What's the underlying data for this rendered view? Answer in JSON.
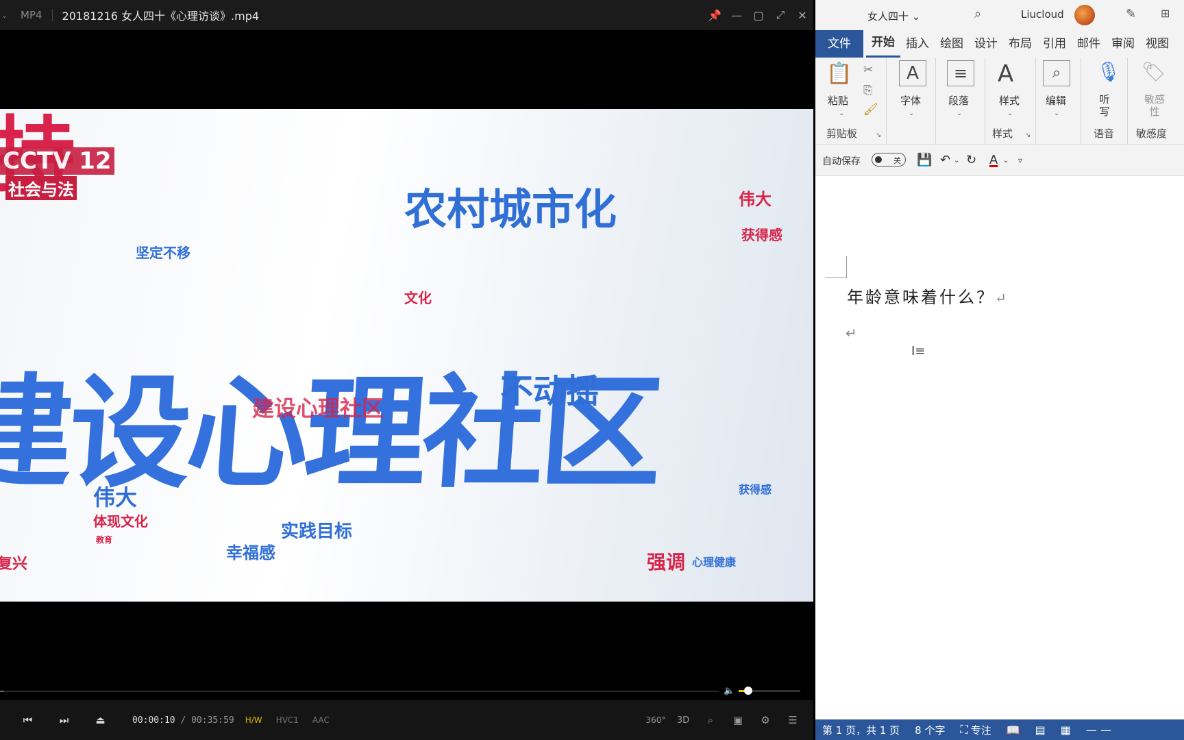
{
  "player": {
    "format": "MP4",
    "filename": "20181216 女人四十《心理访谈》.mp4",
    "window_buttons": [
      "📌",
      "—",
      "▢",
      "⤢",
      "✕"
    ],
    "video_text": {
      "top_left_red": "持",
      "logo": "CCTV 12",
      "logo_sub": "社会与法",
      "nongcun": "农村城市化",
      "weida": "伟大",
      "huodegan": "获得感",
      "jianding": "坚定不移",
      "wenhua": "文化",
      "big_title": "建设心理社区",
      "sub_red": "建设心理社区",
      "budongyao": "不动摇",
      "weida2": "伟大",
      "tixian": "体现文化",
      "shijian": "实践目标",
      "xingfugan": "幸福感",
      "qiangdiao": "强调",
      "xinlijiankang": "心理健康",
      "huodegan2": "获得感",
      "fuxing": "复兴",
      "jiaoyu": "教育"
    },
    "volume_level": 0.15,
    "time_current": "00:00:10",
    "time_total": "00:35:59",
    "tags": [
      "H/W",
      "HVC1",
      "AAC"
    ],
    "right_buttons": [
      "360°",
      "3D",
      "⌕",
      "▣",
      "⚙",
      "☰"
    ]
  },
  "word": {
    "doc_title": "女人四十",
    "user": "Liucloud",
    "tabs": [
      "文件",
      "开始",
      "插入",
      "绘图",
      "设计",
      "布局",
      "引用",
      "邮件",
      "审阅",
      "视图"
    ],
    "groups": {
      "clipboard": {
        "paste": "粘贴",
        "name": "剪贴板"
      },
      "font": {
        "label": "字体"
      },
      "paragraph": {
        "label": "段落"
      },
      "styles": {
        "label": "样式",
        "name": "样式"
      },
      "editing": {
        "label": "编辑"
      },
      "voice": {
        "label": "听写",
        "name": "语音"
      },
      "sensitivity": {
        "label": "敏感性",
        "name": "敏感度"
      }
    },
    "qat": {
      "autosave": "自动保存",
      "toggle": "关"
    },
    "paragraph1": "年龄意味着什么？",
    "statusbar": {
      "page": "第 1 页，共 1 页",
      "words": "8 个字",
      "focus": "专注"
    }
  }
}
